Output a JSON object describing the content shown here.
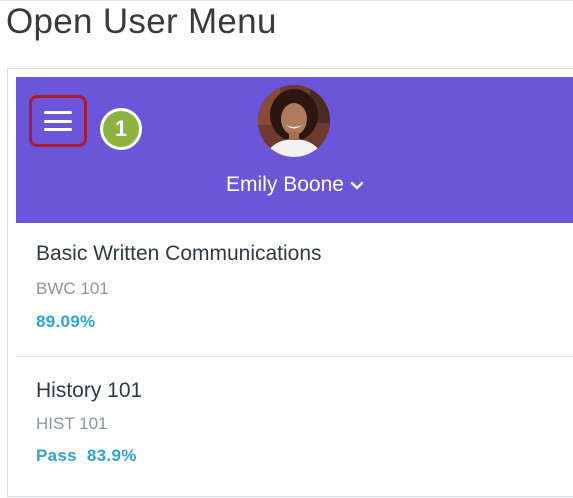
{
  "page": {
    "title": "Open User Menu"
  },
  "header": {
    "menu_icon": "hamburger-menu-icon",
    "step_badge": "1",
    "user_name": "Emily Boone",
    "chevron_icon": "chevron-down-icon",
    "accent_color": "#6b55d9",
    "highlight_color": "#a61e2f",
    "badge_color": "#8ab43d"
  },
  "courses": [
    {
      "name": "Basic Written Communications",
      "code": "BWC 101",
      "grade_label": "",
      "grade": "89.09%"
    },
    {
      "name": "History 101",
      "code": "HIST 101",
      "grade_label": "Pass",
      "grade": "83.9%"
    }
  ],
  "grade_color": "#2aa5d6"
}
